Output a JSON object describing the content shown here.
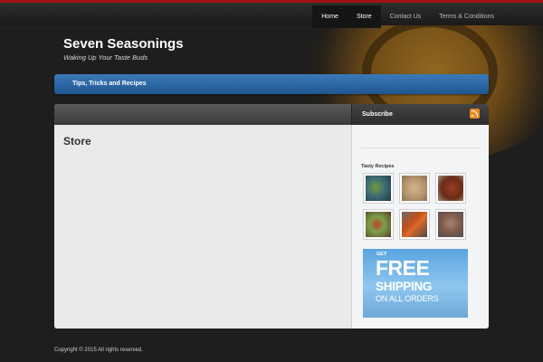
{
  "nav": {
    "items": [
      {
        "label": "Home"
      },
      {
        "label": "Store"
      },
      {
        "label": "Contact Us"
      },
      {
        "label": "Terms & Conditions"
      }
    ]
  },
  "header": {
    "site_title": "Seven Seasonings",
    "tagline": "Waking Up Your Taste Buds"
  },
  "blue_bar": {
    "label": "Tips, Tricks and Recipes"
  },
  "sidebar": {
    "subscribe_label": "Subscribe",
    "widget_title": "Tasty Recipes",
    "ad": {
      "line1": "GET",
      "line2": "FREE",
      "line3": "SHIPPING",
      "line4": "ON ALL ORDERS"
    }
  },
  "main": {
    "page_title": "Store"
  },
  "footer": {
    "copyright": "Copyright © 2015 All rights reserved."
  },
  "colors": {
    "accent_red": "#a01212",
    "blue_bar": "#2a6aa8",
    "rss": "#f08a24"
  },
  "icons": {
    "subscribe": "rss-icon"
  }
}
